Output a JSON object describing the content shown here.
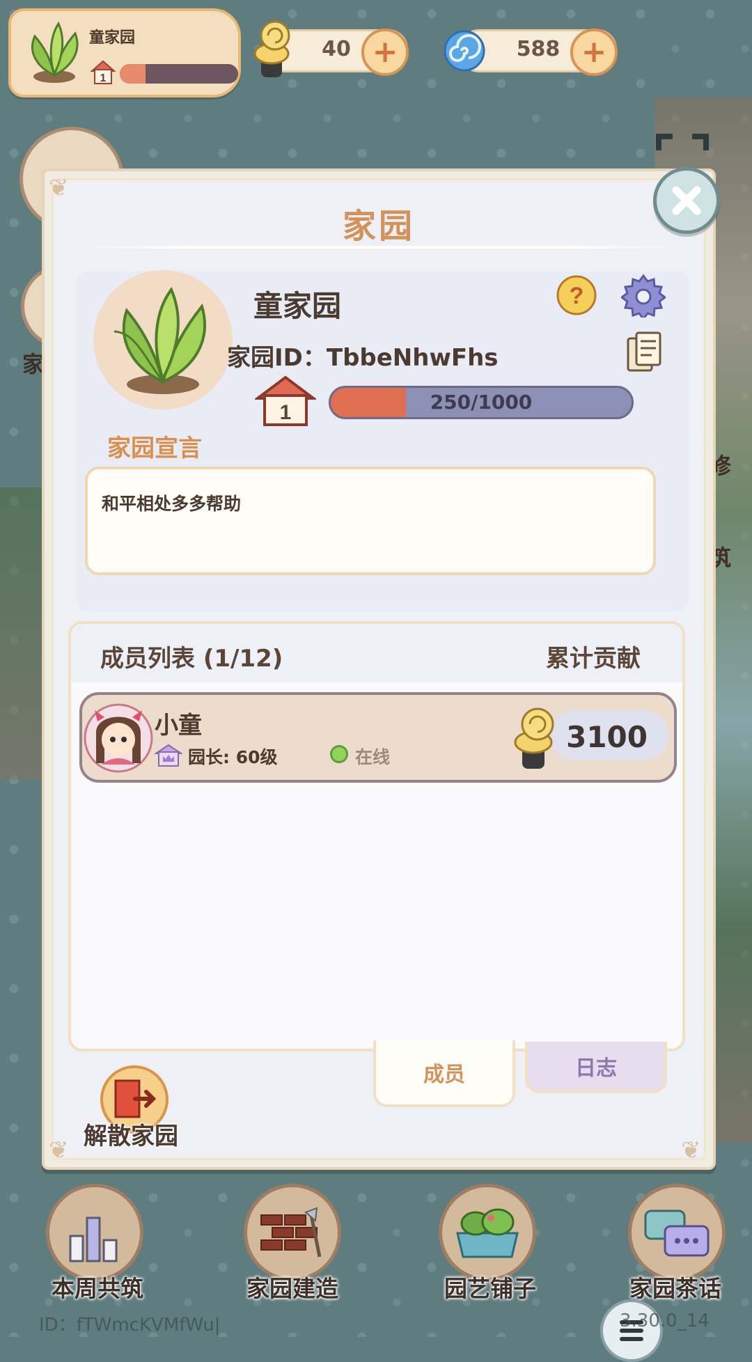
{
  "hud": {
    "garden_name": "童家园",
    "garden_level": "1",
    "garden_progress": 0.22,
    "snail_currency": "40",
    "gem_currency": "588"
  },
  "dialog": {
    "title": "家园",
    "garden_name": "童家园",
    "garden_id_label": "家园ID：",
    "garden_id": "TbbeNhwFhs",
    "level": "1",
    "exp_text": "250/1000",
    "exp_fraction": 0.25,
    "declaration_label": "家园宣言",
    "declaration_text": "和平相处多多帮助"
  },
  "members": {
    "title": "成员列表 (1/12)",
    "contribution_header": "累计贡献",
    "rows": [
      {
        "name": "小童",
        "role": "园长: 60级",
        "status": "在线",
        "contribution": "3100"
      }
    ]
  },
  "tabs": {
    "members": "成员",
    "log": "日志"
  },
  "disband_label": "解散家园",
  "background_partial_labels": {
    "left": "家",
    "right_1": "修",
    "right_2": "筑"
  },
  "bottom_nav": [
    {
      "label": "本周共筑",
      "icon": "weekly-build-icon"
    },
    {
      "label": "家园建造",
      "icon": "bricks-build-icon"
    },
    {
      "label": "园艺铺子",
      "icon": "gardening-shop-icon"
    },
    {
      "label": "家园茶话",
      "icon": "chat-bubbles-icon"
    }
  ],
  "footer": {
    "id_text": "ID：fTWmcKVMfWu|",
    "version_text": "3.30.0_14"
  },
  "colors": {
    "background": "#5f7d7f",
    "title_accent": "#d2925a",
    "exp_fill": "#e06f52",
    "exp_track": "#8c90b4",
    "online": "#8dd35c"
  }
}
